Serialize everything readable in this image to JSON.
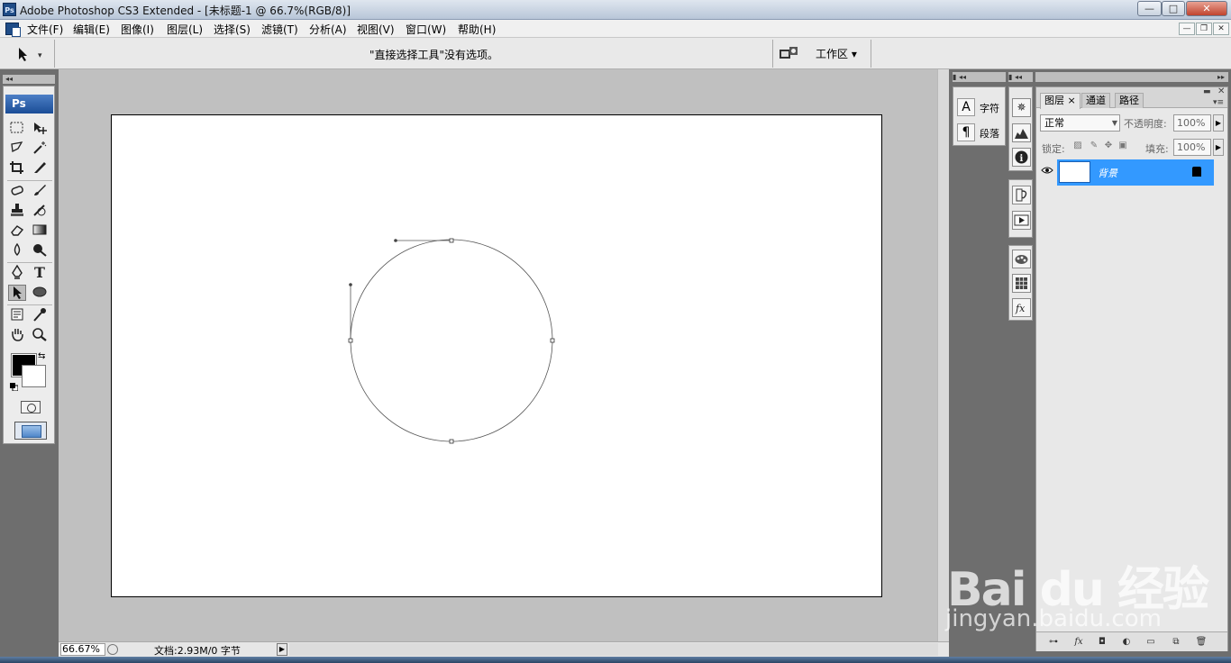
{
  "window": {
    "title": "Adobe Photoshop CS3 Extended - [未标题-1 @ 66.7%(RGB/8)]",
    "app_icon_text": "Ps",
    "controls": {
      "minimize": "—",
      "maximize": "□",
      "close": "✕"
    }
  },
  "menu": [
    "文件(F)",
    "编辑(E)",
    "图像(I)",
    "图层(L)",
    "选择(S)",
    "滤镜(T)",
    "分析(A)",
    "视图(V)",
    "窗口(W)",
    "帮助(H)"
  ],
  "doc_controls": {
    "minimize": "—",
    "restore": "❐",
    "close": "✕"
  },
  "options_bar": {
    "tool_arrow": "▾",
    "message": "\"直接选择工具\"没有选项。",
    "workspace_label": "工作区 ▾"
  },
  "tools": {
    "header": "◂◂",
    "logo": "Ps"
  },
  "status": {
    "zoom": "66.67%",
    "doc_info": "文档:2.93M/0 字节",
    "arrow": "▶"
  },
  "dock": {
    "header_left": "▮ ◂◂",
    "header_mid": "▮ ◂◂",
    "header_right": "▸▸"
  },
  "char_panel": {
    "character_label": "字符",
    "paragraph_label": "段落",
    "character_icon": "A",
    "paragraph_icon": "¶"
  },
  "layers": {
    "tabs": [
      "图层",
      "通道",
      "路径"
    ],
    "tab_close": "×",
    "blend_mode": "正常",
    "opacity_label": "不透明度:",
    "opacity_value": "100%",
    "lock_label": "锁定:",
    "fill_label": "填充:",
    "fill_value": "100%",
    "items": [
      {
        "name": "背景",
        "visible": true,
        "locked": true,
        "selected": true
      }
    ],
    "accent_color": "#3399ff"
  },
  "watermark": {
    "brand": "Bai du 经验",
    "url": "jingyan.baidu.com"
  }
}
